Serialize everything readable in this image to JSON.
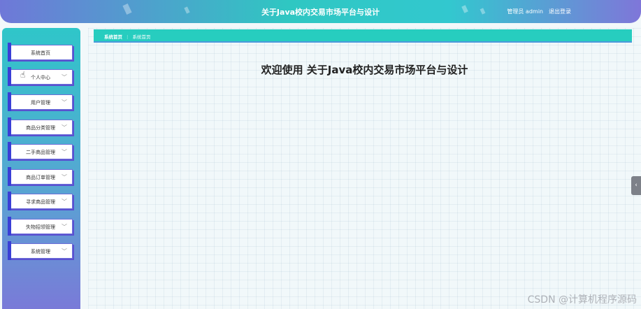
{
  "header": {
    "title": "关于Java校内交易市场平台与设计",
    "user_label": "管理员 admin",
    "logout_label": "退出登录"
  },
  "sidebar": {
    "items": [
      {
        "label": "系统首页",
        "has_chevron": false
      },
      {
        "label": "个人中心",
        "has_chevron": true
      },
      {
        "label": "用户管理",
        "has_chevron": true
      },
      {
        "label": "商品分类管理",
        "has_chevron": true
      },
      {
        "label": "二手商品管理",
        "has_chevron": true
      },
      {
        "label": "商品订单管理",
        "has_chevron": true
      },
      {
        "label": "寻求商品管理",
        "has_chevron": true
      },
      {
        "label": "失物招领管理",
        "has_chevron": true
      },
      {
        "label": "系统管理",
        "has_chevron": true
      }
    ]
  },
  "breadcrumb": {
    "home": "系统首页",
    "separator": "⋮",
    "current": "系统首页"
  },
  "main": {
    "welcome": "欢迎使用 关于Java校内交易市场平台与设计"
  },
  "watermark": "CSDN @计算机程序源码",
  "icons": {
    "chevron": "chevron-down-icon",
    "cursor": "hand-cursor-icon",
    "collapse_tab": "chevron-left-icon"
  },
  "colors": {
    "header_gradient_start": "#6f78d8",
    "header_gradient_mid": "#2fc7c2",
    "breadcrumb_bg": "#27cdbf",
    "menu_accent": "#3a3fd6"
  }
}
